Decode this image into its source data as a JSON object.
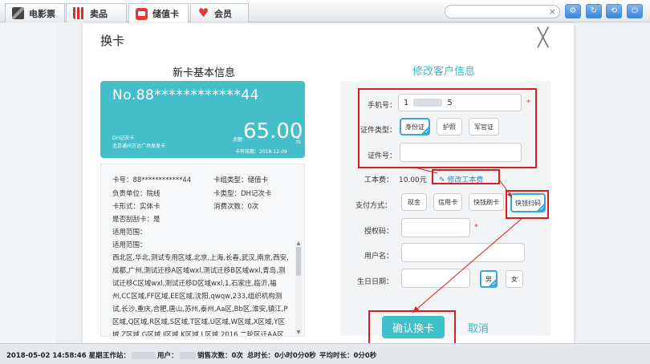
{
  "tabs": [
    {
      "label": "电影票",
      "icon": "film-icon"
    },
    {
      "label": "卖品",
      "icon": "popcorn-icon"
    },
    {
      "label": "储值卡",
      "icon": "card-icon",
      "active": true
    },
    {
      "label": "会员",
      "icon": "heart-icon"
    }
  ],
  "search": {
    "value": "",
    "clear": "×"
  },
  "modal": {
    "title": "换卡",
    "close": "╳",
    "left_title": "新卡基本信息",
    "right_title": "修改客户信息"
  },
  "card": {
    "number": "No.88************44",
    "type": "DH记次卡",
    "address": "北京通州万达广场发发卡",
    "balance_label": "余额",
    "balance": "65.00",
    "unit": "元",
    "valid": "卡有效期：2018-12-09"
  },
  "card_info": {
    "card_no": "卡号：88************44",
    "card_category": "卡组类型：储值卡",
    "unit": "负责单位：院线",
    "card_type": "卡类型：DH记次卡",
    "form": "卡形式：实体卡",
    "consume": "消费次数：0次",
    "scratch": "是否刮刮卡：是",
    "scope1": "适用范围：",
    "scope2": "适用范围：",
    "scope_desc": "西北区,华北,测试专用区域,北京,上海,长春,武汉,南京,西安,成都,广州,测试迁移A区域wxl,测试迁移B区域wxl,青岛,测试迁移C区域wxl,测试迁移D区域wxl,1,石家庄,临沂,福州,CC区域,FF区域,EE区域,沈阳,qwqw,233,组织机构测试,长沙,重庆,合肥,唐山,苏州,泰州,Aa区,Bb区,淮安,镇江,P区域,Q区域,R区域,S区域,T区域,U区域,W区域,X区域,Y区域,Z区域,G区域,I区域,K区域,L区域,2016,二轮区迁AA区wpf,二轮区迁BB区wpf,二轮区"
  },
  "form": {
    "phone_label": "手机号：",
    "phone_value_start": "1",
    "phone_value_end": "5",
    "id_type_label": "证件类型：",
    "id_types": [
      "身份证",
      "护照",
      "军官证"
    ],
    "id_no_label": "证件号：",
    "fee_label": "工本费：",
    "fee_value": "10.00元",
    "fee_link": "修改工本费",
    "pay_label": "支付方式：",
    "pay_methods": [
      "现金",
      "信用卡",
      "快钱刷卡",
      "快钱扫码"
    ],
    "auth_label": "授权码：",
    "username_label": "用户名：",
    "birthday_label": "生日日期：",
    "genders": [
      "男",
      "女"
    ],
    "required": "*"
  },
  "actions": {
    "confirm": "确认换卡",
    "cancel": "取消"
  },
  "status": {
    "datetime": "2018-05-02 14:58:46 星期三",
    "station_label": "工作站：",
    "user_label": "用户：",
    "sales": "销售次数：0次",
    "total_time": "总时长：0小时0分0秒",
    "avg_time": "平均时长：0分0秒"
  },
  "colors": {
    "accent": "#44bec9",
    "annotation": "#d61f1f",
    "selected": "#3aa5e0"
  }
}
